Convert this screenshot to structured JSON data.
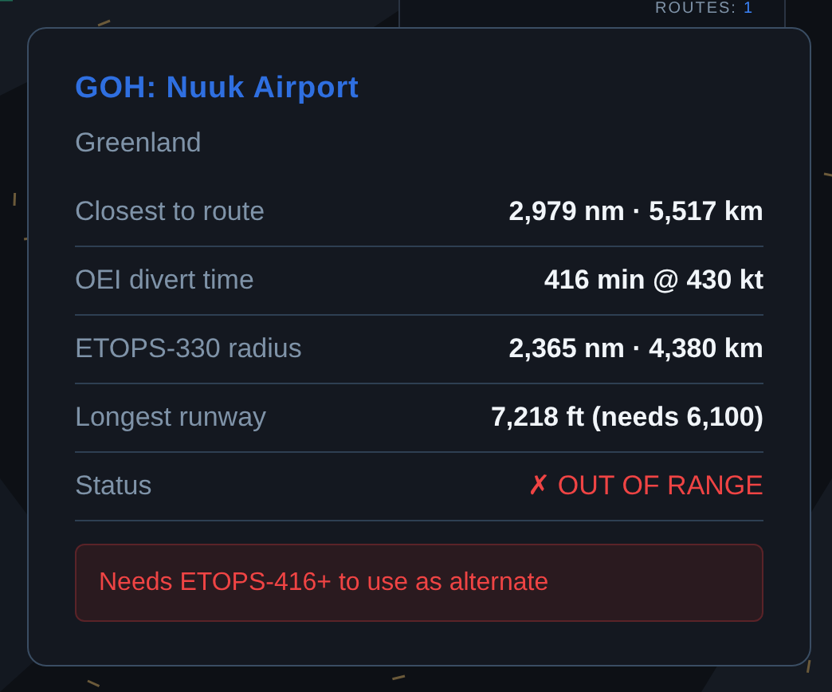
{
  "routes_panel": {
    "label": "ROUTES:",
    "count": "1"
  },
  "airport_card": {
    "title": "GOH: Nuuk Airport",
    "subtitle": "Greenland",
    "rows": [
      {
        "label": "Closest to route",
        "value": "2,979 nm · 5,517 km",
        "kind": "normal"
      },
      {
        "label": "OEI divert time",
        "value": "416 min @ 430 kt",
        "kind": "normal"
      },
      {
        "label": "ETOPS-330 radius",
        "value": "2,365 nm · 4,380 km",
        "kind": "normal"
      },
      {
        "label": "Longest runway",
        "value": "7,218 ft (needs 6,100)",
        "kind": "normal"
      },
      {
        "label": "Status",
        "value": "✗ OUT OF RANGE",
        "kind": "alert"
      }
    ],
    "warning": "Needs ETOPS-416+ to use as alternate"
  }
}
